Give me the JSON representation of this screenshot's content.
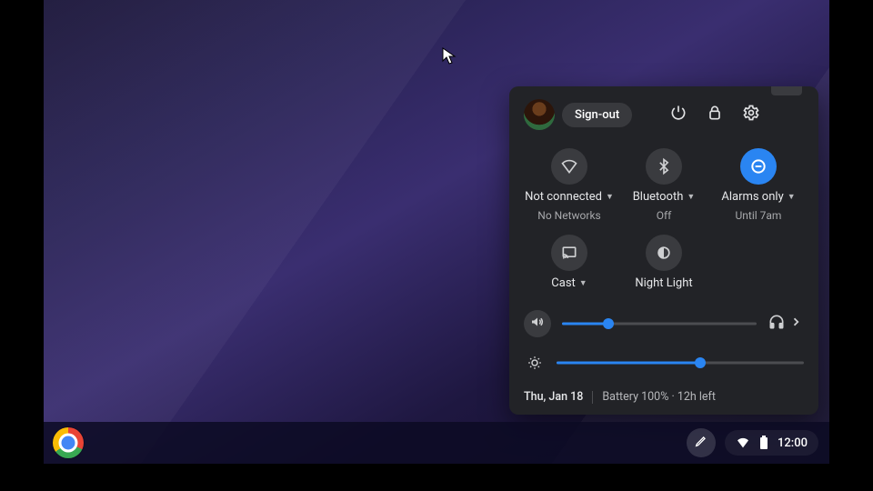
{
  "colors": {
    "accent": "#2a85f2"
  },
  "header": {
    "signout_label": "Sign-out"
  },
  "tiles": {
    "wifi": {
      "title": "Not connected",
      "subtitle": "No Networks",
      "has_caret": true,
      "active": false
    },
    "bluetooth": {
      "title": "Bluetooth",
      "subtitle": "Off",
      "has_caret": true,
      "active": false
    },
    "dnd": {
      "title": "Alarms only",
      "subtitle": "Until 7am",
      "has_caret": true,
      "active": true
    },
    "cast": {
      "title": "Cast",
      "subtitle": "",
      "has_caret": true,
      "active": false
    },
    "nightlight": {
      "title": "Night Light",
      "subtitle": "",
      "has_caret": false,
      "active": false
    }
  },
  "sliders": {
    "volume": {
      "percent": 24
    },
    "brightness": {
      "percent": 58
    }
  },
  "footer": {
    "date": "Thu, Jan 18",
    "battery": "Battery 100% · 12h left"
  },
  "shelf": {
    "clock": "12:00"
  }
}
